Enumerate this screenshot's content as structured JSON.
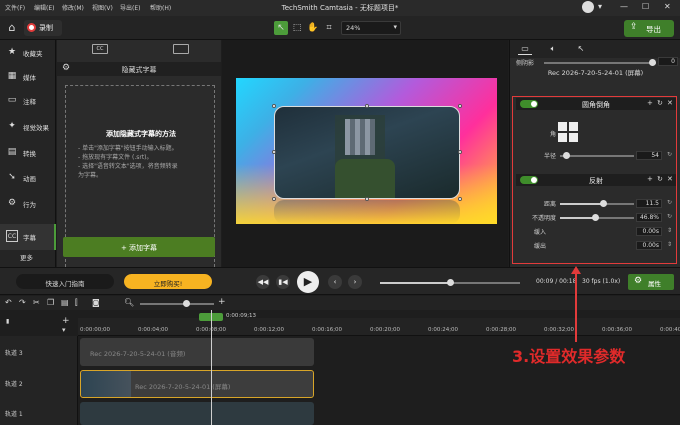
{
  "menubar": {
    "items": [
      "文件(F)",
      "编辑(E)",
      "修改(M)",
      "视图(V)",
      "导出(E)",
      "帮助(H)"
    ],
    "title": "TechSmith Camtasia - 无标题项目*"
  },
  "toolbar": {
    "record_label": "录制",
    "zoom_value": "24%",
    "export_label": "导出"
  },
  "leftnav": {
    "items": [
      "收藏夹",
      "媒体",
      "注释",
      "视觉效果",
      "转换",
      "动画",
      "行为",
      "字幕"
    ],
    "more_label": "更多"
  },
  "captions": {
    "header": "隐藏式字幕",
    "how_title": "添加隐藏式字幕的方法",
    "how_lines": [
      "- 单击\"添加字幕\"按钮手动输入标题。",
      "- 拖放现有字幕文件 (.srt)。",
      "- 选择\"语音转文本\"选项，将音频转录",
      "为字幕。"
    ],
    "add_button": "+ 添加字幕"
  },
  "properties": {
    "opacity_label": "侧阴影",
    "opacity_value": "0",
    "clip_title": "Rec 2026-7-20-5-24-01 (屏幕)",
    "rounded": {
      "title": "圆角倒角",
      "corner_label": "角",
      "radius_label": "半径",
      "radius_value": "54",
      "radius_fraction": 0.08
    },
    "reflection": {
      "title": "反射",
      "distance_label": "距离",
      "distance_value": "11.5",
      "distance_fraction": 0.58,
      "opacity_label": "不透明度",
      "opacity_value": "46.8%",
      "opacity_fraction": 0.47,
      "fadein_label": "缓入",
      "fadein_value": "0.00s",
      "fadeout_label": "缓出",
      "fadeout_value": "0.00s"
    }
  },
  "player": {
    "guide_label": "快速入门指南",
    "buy_label": "立即购买!",
    "time": "00:09 / 00:18",
    "fps": "30 fps (1.0x)",
    "props_label": "属性",
    "progress": 0.5
  },
  "timeline": {
    "playhead_time": "0:00:09;13",
    "ruler": [
      "0:00:00;00",
      "0:00:04;00",
      "0:00:08;00",
      "0:00:12;00",
      "0:00:16;00",
      "0:00:20;00",
      "0:00:24;00",
      "0:00:28;00",
      "0:00:32;00",
      "0:00:36;00",
      "0:00:40;00"
    ],
    "tracks": [
      {
        "label": "轨道 3",
        "clip": "Rec 2026-7-20-5-24-01 (音频)"
      },
      {
        "label": "轨道 2",
        "clip": "Rec 2026-7-20-5-24-01 (屏幕)"
      },
      {
        "label": "轨道 1",
        "clip": ""
      }
    ]
  },
  "annotation": {
    "text": "3.设置效果参数"
  },
  "colors": {
    "accent_green": "#3f7f2a",
    "buy_yellow": "#f7b321",
    "annotation_red": "#e23b3b"
  }
}
